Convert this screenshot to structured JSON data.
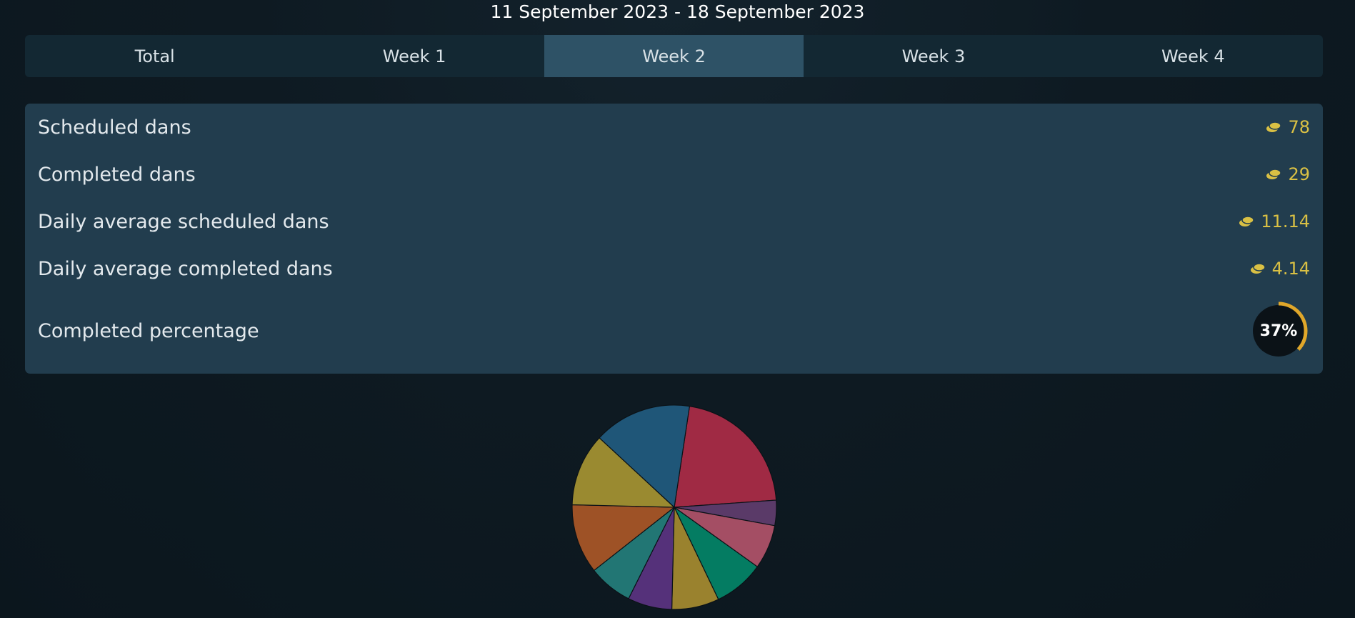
{
  "header": {
    "date_range": "11 September 2023 - 18 September 2023"
  },
  "tabs": [
    {
      "label": "Total",
      "active": false
    },
    {
      "label": "Week 1",
      "active": false
    },
    {
      "label": "Week 2",
      "active": true
    },
    {
      "label": "Week 3",
      "active": false
    },
    {
      "label": "Week 4",
      "active": false
    }
  ],
  "stats": {
    "scheduled": {
      "label": "Scheduled dans",
      "value": "78",
      "icon": "coins-icon"
    },
    "completed": {
      "label": "Completed dans",
      "value": "29",
      "icon": "coins-icon"
    },
    "daily_scheduled": {
      "label": "Daily average scheduled dans",
      "value": "11.14",
      "icon": "coins-icon"
    },
    "daily_completed": {
      "label": "Daily average completed dans",
      "value": "4.14",
      "icon": "coins-icon"
    },
    "percentage": {
      "label": "Completed percentage",
      "value_text": "37%",
      "value": 37
    }
  },
  "colors": {
    "accent_gold": "#d9c044",
    "gauge_ring": "#e0a72a",
    "active_tab": "#2e5266",
    "panel": "#223d4e"
  },
  "chart_data": {
    "type": "pie",
    "slices": [
      {
        "value": 21.5,
        "color": "#a02a44"
      },
      {
        "value": 4.0,
        "color": "#5a3a68"
      },
      {
        "value": 7.0,
        "color": "#a44e64"
      },
      {
        "value": 8.0,
        "color": "#047c62"
      },
      {
        "value": 7.5,
        "color": "#9a822e"
      },
      {
        "value": 7.0,
        "color": "#55317a"
      },
      {
        "value": 7.0,
        "color": "#227674"
      },
      {
        "value": 11.0,
        "color": "#9e5226"
      },
      {
        "value": 11.5,
        "color": "#9a8a30"
      },
      {
        "value": 15.5,
        "color": "#1f5678"
      }
    ]
  }
}
